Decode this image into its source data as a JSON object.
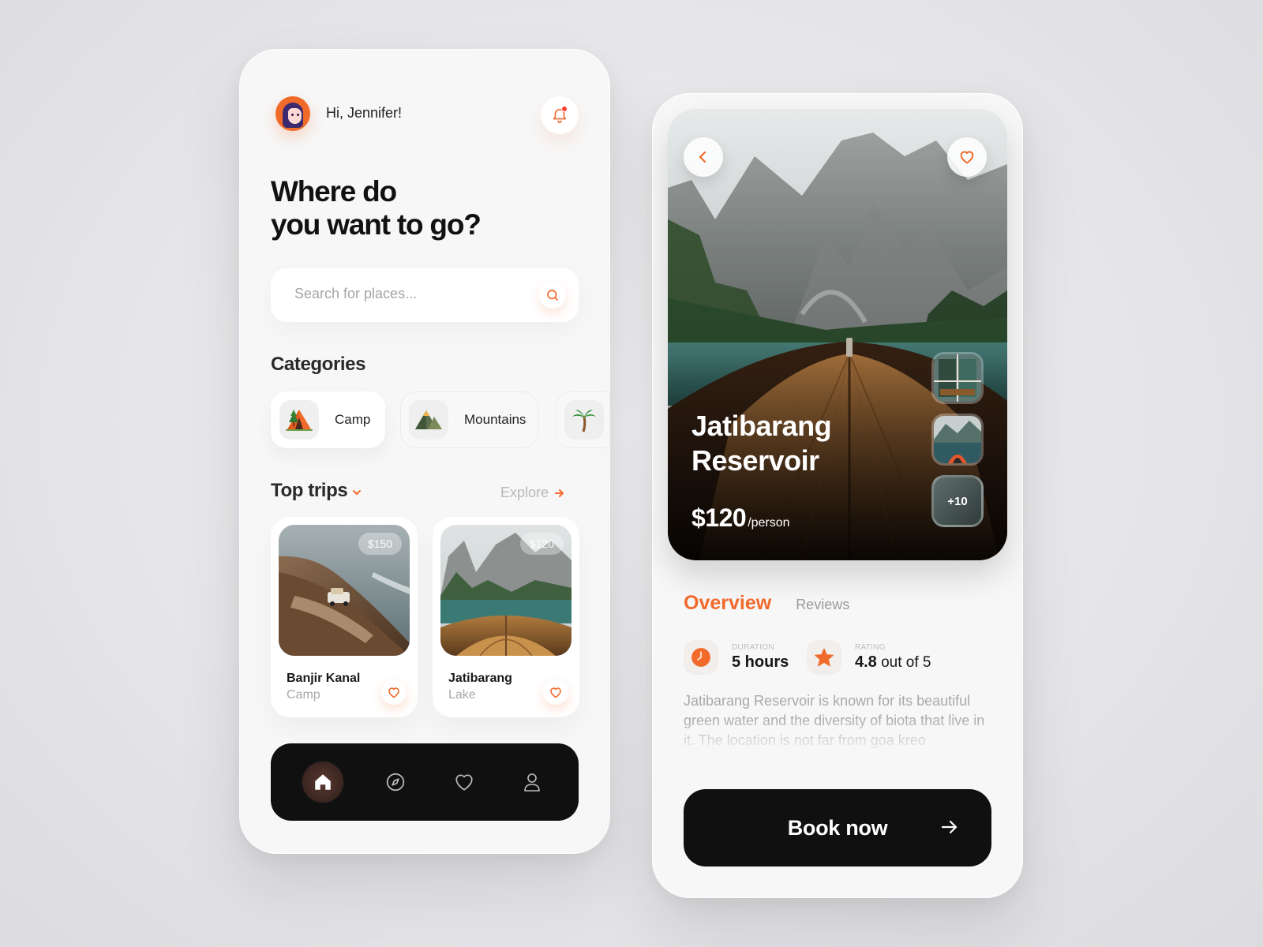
{
  "colors": {
    "accent": "#f16a2c",
    "dark": "#101010",
    "surface": "#f7f7f7"
  },
  "home": {
    "greeting": "Hi, Jennifer!",
    "headline": [
      "Where do",
      "you want to go?"
    ],
    "search": {
      "placeholder": "Search for places..."
    },
    "categories_title": "Categories",
    "categories": [
      {
        "label": "Camp",
        "icon": "tent-icon",
        "active": true
      },
      {
        "label": "Mountains",
        "icon": "mountain-icon",
        "active": false
      },
      {
        "label": "",
        "icon": "palm-tree-icon",
        "active": false
      }
    ],
    "top_trips_title": "Top trips",
    "explore_label": "Explore",
    "trips": [
      {
        "name": "Banjir Kanal",
        "type": "Camp",
        "price": "$150"
      },
      {
        "name": "Jatibarang",
        "type": "Lake",
        "price": "$120"
      }
    ],
    "nav": [
      "home-icon",
      "compass-icon",
      "heart-icon",
      "user-icon"
    ]
  },
  "detail": {
    "title": [
      "Jatibarang",
      "Reservoir"
    ],
    "price": "$120",
    "price_unit": "/person",
    "more_photos": "+10",
    "tabs": [
      "Overview",
      "Reviews"
    ],
    "duration": {
      "label": "DURATION",
      "value": "5 hours"
    },
    "rating": {
      "label": "RATING",
      "value": "4.8",
      "suffix": " out of 5"
    },
    "description": "Jatibarang Reservoir is known for its beautiful green water and the diversity of biota that live in it. The location is not far from goa kreo",
    "book_label": "Book now"
  }
}
